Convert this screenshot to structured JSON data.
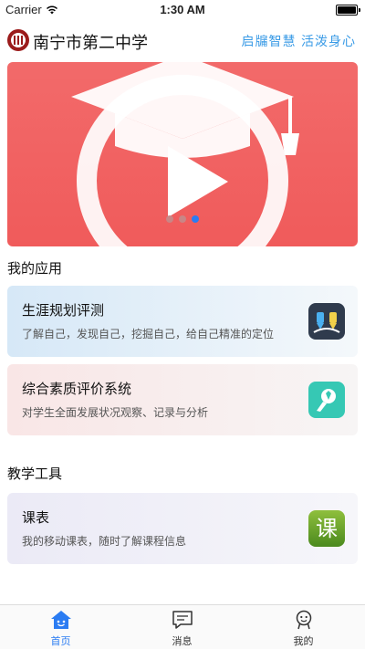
{
  "status_bar": {
    "carrier": "Carrier",
    "time": "1:30 AM"
  },
  "header": {
    "school_name": "南宁市第二中学",
    "slogan": "启牖智慧 活泼身心"
  },
  "banner": {
    "slide_count": 3,
    "active_slide": 3
  },
  "my_apps": {
    "title": "我的应用",
    "items": [
      {
        "title": "生涯规划评测",
        "subtitle": "了解自己，发现自己，挖掘自己，给自己精准的定位",
        "icon": "career-icon"
      },
      {
        "title": "综合素质评价系统",
        "subtitle": "对学生全面发展状况观察、记录与分析",
        "icon": "quality-icon"
      }
    ]
  },
  "teaching_tools": {
    "title": "教学工具",
    "items": [
      {
        "title": "课表",
        "subtitle": "我的移动课表，随时了解课程信息",
        "icon_text": "课"
      }
    ]
  },
  "tabbar": {
    "items": [
      {
        "label": "首页",
        "icon": "home-icon",
        "active": true
      },
      {
        "label": "消息",
        "icon": "message-icon",
        "active": false
      },
      {
        "label": "我的",
        "icon": "profile-icon",
        "active": false
      }
    ],
    "active_color": "#2b7cf2"
  },
  "colors": {
    "slogan": "#3a9be6",
    "banner": "#f05b5b"
  }
}
